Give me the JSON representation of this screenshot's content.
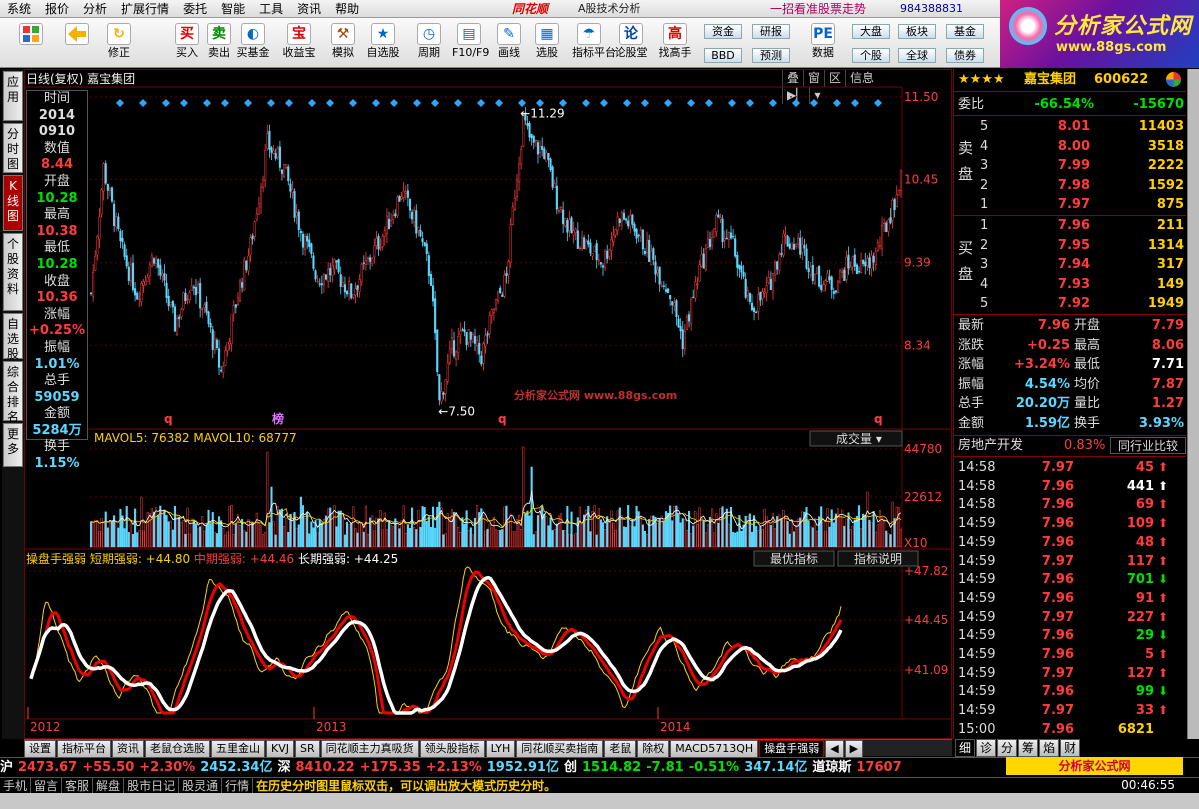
{
  "menu": {
    "items": [
      "系统",
      "报价",
      "分析",
      "扩展行情",
      "委托",
      "智能",
      "工具",
      "资讯",
      "帮助"
    ],
    "brand": "同花顺",
    "brand_sub": "A股技术分析",
    "slogan": "一招看准股票走势",
    "qq": "984388831"
  },
  "toolbar": {
    "buttons": [
      {
        "label": "",
        "icon": "grid-icon"
      },
      {
        "label": "",
        "icon": "back-arrow-icon"
      },
      {
        "label": "修正",
        "icon": "refresh-icon"
      },
      {
        "label": "买入",
        "glyph": "买"
      },
      {
        "label": "卖出",
        "glyph": "卖"
      },
      {
        "label": "买基金",
        "glyph": "◐"
      },
      {
        "label": "收益宝",
        "glyph": "宝"
      },
      {
        "label": "模拟",
        "glyph": "⚒"
      },
      {
        "label": "自选股",
        "glyph": "★"
      },
      {
        "label": "周期",
        "glyph": "◷"
      },
      {
        "label": "F10/F9",
        "glyph": "▤"
      },
      {
        "label": "画线",
        "glyph": "✎"
      },
      {
        "label": "选股",
        "glyph": "▦"
      },
      {
        "label": "指标平台",
        "glyph": "☂"
      },
      {
        "label": "论股堂",
        "glyph": "论"
      },
      {
        "label": "找高手",
        "glyph": "高"
      },
      {
        "label": "数据",
        "glyph": "PE"
      }
    ],
    "right_buttons": [
      "资金",
      "研报",
      "BBD",
      "预测",
      "大盘",
      "板块",
      "基金",
      "个股",
      "全球",
      "债券"
    ]
  },
  "logo": {
    "text": "分析家公式网",
    "url_text": "www.88gs.com"
  },
  "left_tabs": [
    "应用",
    "分时图",
    "K线图",
    "个股资料",
    "自选股",
    "综合排名",
    "更多"
  ],
  "chart": {
    "title": "日线(复权)  嘉宝集团",
    "buttons": [
      "叠",
      "窗",
      "区",
      "信息"
    ],
    "price_axis": [
      "11.50",
      "10.45",
      "9.39",
      "8.34"
    ],
    "high_label": "11.29",
    "low_label": "7.50",
    "watermark": "分析家公式网 www.88gs.com",
    "markers": [
      "q",
      "榜",
      "q",
      "q"
    ],
    "vol_title": "MAVOL5: 76382  MAVOL10: 68777",
    "vol_name": "成交量",
    "vol_axis": [
      "44780",
      "22612",
      "X10"
    ],
    "ind_title": "操盘手强弱",
    "ind_short": "短期强弱: +44.80",
    "ind_mid": "中期强弱: +44.46",
    "ind_long": "长期强弱: +44.25",
    "ind_btns": [
      "最优指标",
      "指标说明"
    ],
    "ind_axis": [
      "+47.82",
      "+44.45",
      "+41.09"
    ],
    "years": [
      "2012",
      "2013",
      "2014"
    ]
  },
  "datawin": {
    "items": [
      {
        "label": "时间",
        "value": "2014",
        "color": "#ddd"
      },
      {
        "label": "",
        "value": "0910",
        "color": "#ddd"
      },
      {
        "label": "数值",
        "value": "8.44",
        "color": "#ff3c3c"
      },
      {
        "label": "开盘",
        "value": "10.28",
        "color": "#00e000"
      },
      {
        "label": "最高",
        "value": "10.38",
        "color": "#ff3c3c"
      },
      {
        "label": "最低",
        "value": "10.28",
        "color": "#00e000"
      },
      {
        "label": "收盘",
        "value": "10.36",
        "color": "#ff3c3c"
      },
      {
        "label": "涨幅",
        "value": "+0.25%",
        "color": "#ff3c3c"
      },
      {
        "label": "振幅",
        "value": "1.01%",
        "color": "#5ad8ff"
      },
      {
        "label": "总手",
        "value": "59059",
        "color": "#5ad8ff"
      },
      {
        "label": "金额",
        "value": "5284万",
        "color": "#5ad8ff"
      },
      {
        "label": "换手",
        "value": "1.15%",
        "color": "#5ad8ff"
      }
    ]
  },
  "stock": {
    "stars": "★★★★",
    "name": "嘉宝集团",
    "code": "600622",
    "weibi_label": "委比",
    "weibi": "-66.54%",
    "weicha": "-15670",
    "sell_label": "卖盘",
    "buy_label": "买盘",
    "asks": [
      {
        "lvl": "5",
        "price": "8.01",
        "vol": "11403"
      },
      {
        "lvl": "4",
        "price": "8.00",
        "vol": "3518"
      },
      {
        "lvl": "3",
        "price": "7.99",
        "vol": "2222"
      },
      {
        "lvl": "2",
        "price": "7.98",
        "vol": "1592"
      },
      {
        "lvl": "1",
        "price": "7.97",
        "vol": "875"
      }
    ],
    "bids": [
      {
        "lvl": "1",
        "price": "7.96",
        "vol": "211"
      },
      {
        "lvl": "2",
        "price": "7.95",
        "vol": "1314"
      },
      {
        "lvl": "3",
        "price": "7.94",
        "vol": "317"
      },
      {
        "lvl": "4",
        "price": "7.93",
        "vol": "149"
      },
      {
        "lvl": "5",
        "price": "7.92",
        "vol": "1949"
      }
    ],
    "quote": [
      {
        "l1": "最新",
        "v1": "7.96",
        "c1": "#ff3c3c",
        "l2": "开盘",
        "v2": "7.79",
        "c2": "#ff3c3c"
      },
      {
        "l1": "涨跌",
        "v1": "+0.25",
        "c1": "#ff3c3c",
        "l2": "最高",
        "v2": "8.06",
        "c2": "#ff3c3c"
      },
      {
        "l1": "涨幅",
        "v1": "+3.24%",
        "c1": "#ff3c3c",
        "l2": "最低",
        "v2": "7.71",
        "c2": "#fff"
      },
      {
        "l1": "振幅",
        "v1": "4.54%",
        "c1": "#5ad8ff",
        "l2": "均价",
        "v2": "7.87",
        "c2": "#ff3c3c"
      },
      {
        "l1": "总手",
        "v1": "20.20万",
        "c1": "#5ad8ff",
        "l2": "量比",
        "v2": "1.27",
        "c2": "#ff3c3c"
      },
      {
        "l1": "金额",
        "v1": "1.59亿",
        "c1": "#5ad8ff",
        "l2": "换手",
        "v2": "3.93%",
        "c2": "#5ad8ff"
      }
    ],
    "sector": "房地产开发",
    "sector_pct": "0.83%",
    "sector_btn": "同行业比较",
    "ticks": [
      {
        "t": "14:58",
        "p": "7.97",
        "v": "45",
        "d": "up"
      },
      {
        "t": "14:58",
        "p": "7.96",
        "v": "441",
        "d": "upw"
      },
      {
        "t": "14:58",
        "p": "7.96",
        "v": "69",
        "d": "up"
      },
      {
        "t": "14:59",
        "p": "7.96",
        "v": "109",
        "d": "up"
      },
      {
        "t": "14:59",
        "p": "7.96",
        "v": "48",
        "d": "up"
      },
      {
        "t": "14:59",
        "p": "7.97",
        "v": "117",
        "d": "up"
      },
      {
        "t": "14:59",
        "p": "7.96",
        "v": "701",
        "d": "dn"
      },
      {
        "t": "14:59",
        "p": "7.96",
        "v": "91",
        "d": "up"
      },
      {
        "t": "14:59",
        "p": "7.97",
        "v": "227",
        "d": "up"
      },
      {
        "t": "14:59",
        "p": "7.96",
        "v": "29",
        "d": "dn"
      },
      {
        "t": "14:59",
        "p": "7.96",
        "v": "5",
        "d": "up"
      },
      {
        "t": "14:59",
        "p": "7.97",
        "v": "127",
        "d": "up"
      },
      {
        "t": "14:59",
        "p": "7.96",
        "v": "99",
        "d": "dn"
      },
      {
        "t": "14:59",
        "p": "7.97",
        "v": "33",
        "d": "up"
      },
      {
        "t": "15:00",
        "p": "7.96",
        "v": "6821",
        "d": "none"
      }
    ]
  },
  "bottom_tabs": [
    "设置",
    "指标平台",
    "资讯",
    "老鼠仓选股",
    "五里金山",
    "KVJ",
    "SR",
    "同花顺主力真吸货",
    "领头股指标",
    "LYH",
    "同花顺买卖指南",
    "老鼠",
    "除权",
    "MACD5713QH",
    "操盘手强弱"
  ],
  "right_tabs": [
    "细",
    "诊",
    "分",
    "筹",
    "焰",
    "财"
  ],
  "ticker": [
    {
      "text": "沪",
      "color": "#fff"
    },
    {
      "text": "2473.67",
      "color": "#ff3c3c"
    },
    {
      "text": "+55.50",
      "color": "#ff3c3c"
    },
    {
      "text": "+2.30%",
      "color": "#ff3c3c"
    },
    {
      "text": "2452.34亿",
      "color": "#5ad8ff"
    },
    {
      "text": "深",
      "color": "#fff"
    },
    {
      "text": "8410.22",
      "color": "#ff3c3c"
    },
    {
      "text": "+175.35",
      "color": "#ff3c3c"
    },
    {
      "text": "+2.13%",
      "color": "#ff3c3c"
    },
    {
      "text": "1952.91亿",
      "color": "#5ad8ff"
    },
    {
      "text": "创",
      "color": "#fff"
    },
    {
      "text": "1514.82",
      "color": "#00e000"
    },
    {
      "text": "-7.81",
      "color": "#00e000"
    },
    {
      "text": "-0.51%",
      "color": "#00e000"
    },
    {
      "text": "347.14亿",
      "color": "#5ad8ff"
    },
    {
      "text": "道琼斯",
      "color": "#fff"
    },
    {
      "text": "17607",
      "color": "#ff3c3c"
    }
  ],
  "ticker_wm": "分析家公式网 www.88gs.com",
  "status": {
    "keys": [
      "手机",
      "留言",
      "客服",
      "解盘",
      "股市日记",
      "股灵通",
      "行情"
    ],
    "msg": "在历史分时图里鼠标双击，可以调出放大模式历史分时。",
    "time": "00:46:55"
  }
}
